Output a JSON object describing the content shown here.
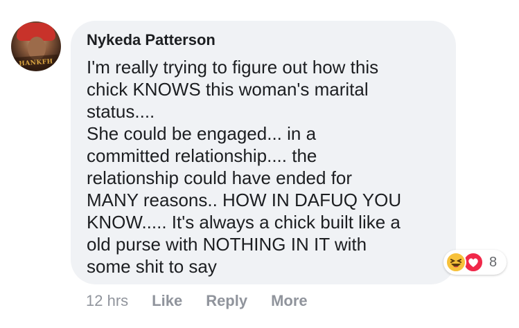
{
  "comment": {
    "avatar_text": "HANKFH",
    "author": "Nykeda Patterson",
    "text": "I'm really trying to figure out how this\nchick KNOWS this woman's marital\nstatus....\nShe could be engaged... in a\ncommitted relationship.... the\nrelationship could have ended for\nMANY reasons.. HOW IN DAFUQ YOU\nKNOW..... It's always a chick built like a\nold purse with NOTHING IN IT with\nsome shit to say",
    "reactions": {
      "icons": [
        "haha-icon",
        "love-icon"
      ],
      "count": "8"
    },
    "timestamp": "12 hrs",
    "actions": {
      "like": "Like",
      "reply": "Reply",
      "more": "More"
    }
  },
  "colors": {
    "bubble": "#f0f2f5",
    "text": "#1c1e21",
    "muted": "#90949c",
    "haha": "#f7c13a",
    "love": "#f0284a"
  }
}
